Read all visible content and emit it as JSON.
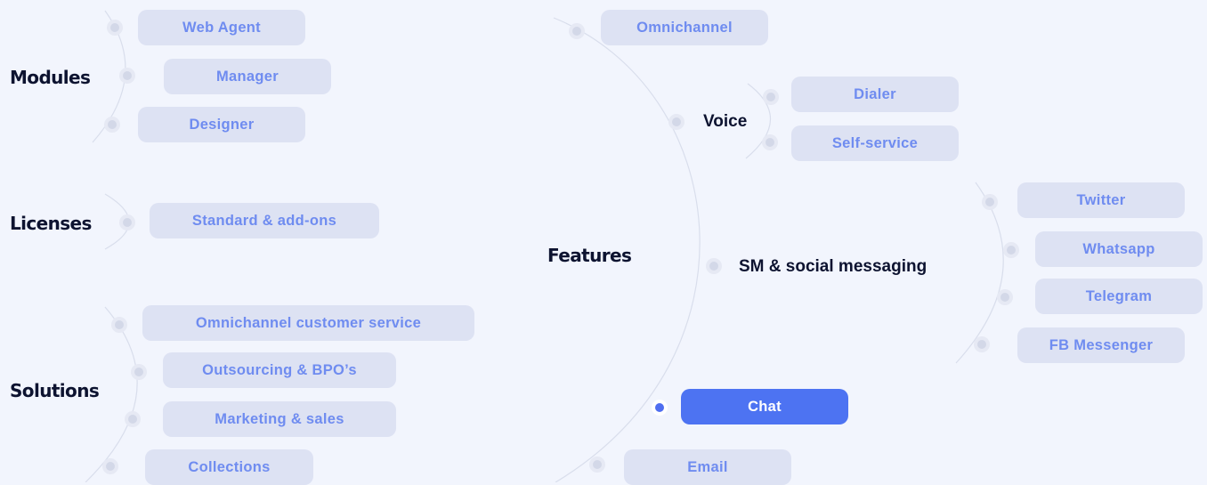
{
  "colors": {
    "background": "#f2f5fd",
    "pill": "#dde2f3",
    "pill_text": "#6f8cf0",
    "active_pill": "#4d73f2",
    "active_pill_text": "#ffffff",
    "heading": "#0d1330",
    "connector": "#d9deec"
  },
  "modules": {
    "label": "Modules",
    "items": [
      "Web Agent",
      "Manager",
      "Designer"
    ]
  },
  "licenses": {
    "label": "Licenses",
    "items": [
      "Standard & add-ons"
    ]
  },
  "solutions": {
    "label": "Solutions",
    "items": [
      "Omnichannel customer service",
      "Outsourcing & BPO’s",
      "Marketing & sales",
      "Collections"
    ]
  },
  "features": {
    "label": "Features",
    "omnichannel": "Omnichannel",
    "voice": {
      "label": "Voice",
      "items": [
        "Dialer",
        "Self-service"
      ]
    },
    "social": {
      "label": "SM & social messaging",
      "items": [
        "Twitter",
        "Whatsapp",
        "Telegram",
        "FB Messenger"
      ]
    },
    "chat": "Chat",
    "email": "Email",
    "active_item": "Chat"
  }
}
